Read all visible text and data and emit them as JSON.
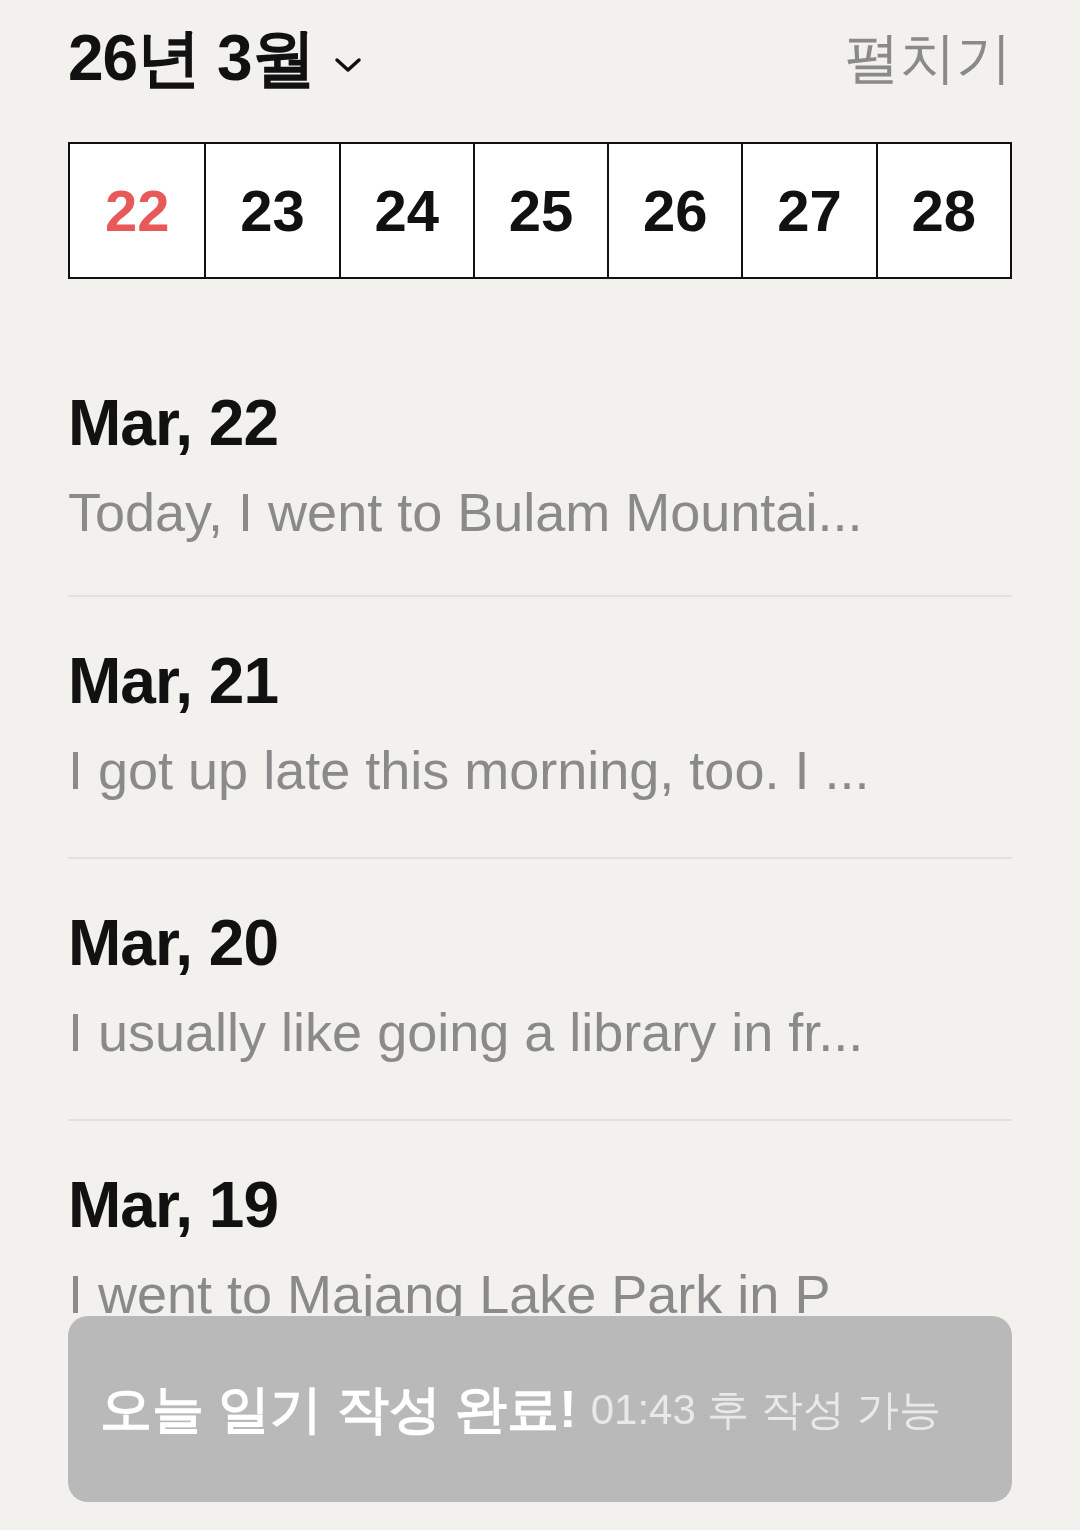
{
  "header": {
    "title": "26년 3월",
    "expand_label": "펼치기"
  },
  "week": [
    {
      "day": "22",
      "selected": true
    },
    {
      "day": "23",
      "selected": false
    },
    {
      "day": "24",
      "selected": false
    },
    {
      "day": "25",
      "selected": false
    },
    {
      "day": "26",
      "selected": false
    },
    {
      "day": "27",
      "selected": false
    },
    {
      "day": "28",
      "selected": false
    }
  ],
  "entries": [
    {
      "date": "Mar, 22",
      "preview": "Today, I went to Bulam Mountai..."
    },
    {
      "date": "Mar, 21",
      "preview": "I got up late this morning, too.  I ..."
    },
    {
      "date": "Mar, 20",
      "preview": "I usually like going a library in fr..."
    },
    {
      "date": "Mar, 19",
      "preview": "I went to Majang Lake Park in P"
    }
  ],
  "toast": {
    "message": "오늘 일기 작성 완료!",
    "detail": "01:43 후 작성 가능"
  }
}
